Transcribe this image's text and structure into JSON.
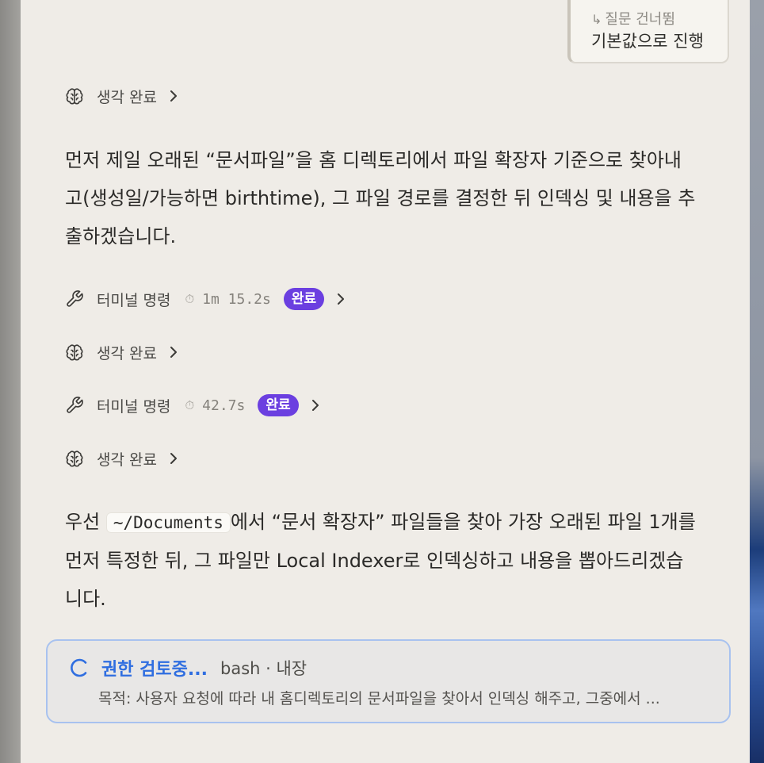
{
  "question_skip": {
    "arrow": "↳",
    "label": "질문 건너뜀",
    "value": "기본값으로 진행"
  },
  "steps": [
    {
      "icon": "brain-icon",
      "label": "생각 완료"
    },
    {
      "icon": "wrench-icon",
      "label": "터미널 명령",
      "timer_icon": "⏱",
      "duration": "1m 15.2s",
      "status": "완료"
    },
    {
      "icon": "brain-icon",
      "label": "생각 완료"
    },
    {
      "icon": "wrench-icon",
      "label": "터미널 명령",
      "timer_icon": "⏱",
      "duration": "42.7s",
      "status": "완료"
    },
    {
      "icon": "brain-icon",
      "label": "생각 완료"
    }
  ],
  "message1": "먼저 제일 오래된 “문서파일”을 홈 디렉토리에서 파일 확장자 기준으로 찾아내고(생성일/가능하면 birthtime), 그 파일 경로를 결정한 뒤 인덱싱 및 내용을 추출하겠습니다.",
  "message2": {
    "prefix": "우선",
    "code": "~/Documents",
    "suffix": "에서 “문서 확장자” 파일들을 찾아 가장 오래된 파일 1개를 먼저 특정한 뒤, 그 파일만 Local Indexer로 인덱싱하고 내용을 뽑아드리겠습니다."
  },
  "permission": {
    "status": "권한 검토중...",
    "tool": "bash · 내장",
    "purpose": "목적: 사용자 요청에 따라 내 홈디렉토리의 문서파일을 찾아서 인덱싱 해주고, 그중에서 ..."
  },
  "colors": {
    "badge": "#6b3fe0",
    "accent_blue": "#2f6ee0",
    "panel_bg": "#efece7"
  }
}
